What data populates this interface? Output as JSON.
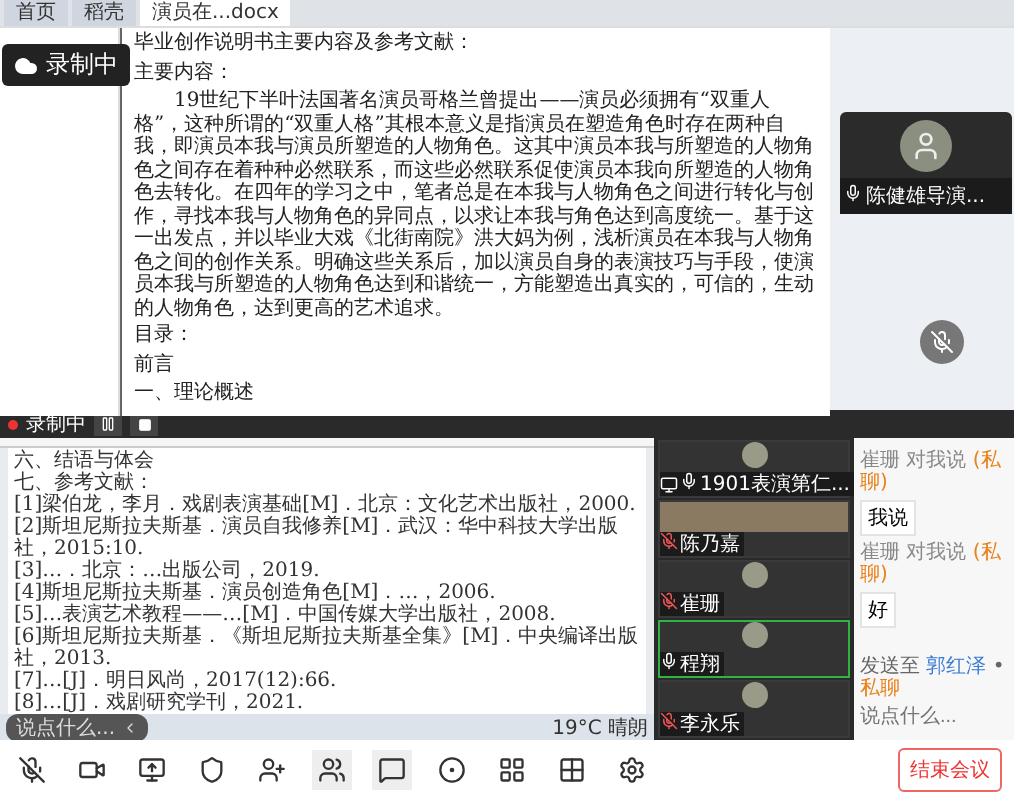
{
  "top_doc": {
    "tabs": [
      {
        "label": "首页",
        "selected": false
      },
      {
        "label": "稻壳",
        "selected": false
      },
      {
        "label": "演员在...docx",
        "selected": true
      }
    ],
    "recording_badge": "录制中",
    "heading": "毕业创作说明书主要内容及参考文献：",
    "subheading": "主要内容：",
    "paragraph": "19世纪下半叶法国著名演员哥格兰曾提出——演员必须拥有“双重人格”，这种所谓的“双重人格”其根本意义是指演员在塑造角色时存在两种自我，即演员本我与演员所塑造的人物角色。这其中演员本我与所塑造的人物角色之间存在着种种必然联系，而这些必然联系促使演员本我向所塑造的人物角色去转化。在四年的学习之中，笔者总是在本我与人物角色之间进行转化与创作，寻找本我与人物角色的异同点，以求让本我与角色达到高度统一。基于这一出发点，并以毕业大戏《北街南院》洪大妈为例，浅析演员在本我与人物角色之间的创作关系。明确这些关系后，加以演员自身的表演技巧与手段，使演员本我与所塑造的人物角色达到和谐统一，方能塑造出真实的，可信的，生动的人物角色，达到更高的艺术追求。",
    "outline": [
      "目录：",
      "前言",
      "一、理论概述"
    ]
  },
  "floating_participant": {
    "name": "陈健雄导演...",
    "muted": false
  },
  "recording_bar": {
    "label": "录制中"
  },
  "shared_doc": {
    "section_title": "六、结语与体会",
    "references_title": "七、参考文献：",
    "references": [
      "[1]梁伯龙，李月．戏剧表演基础[M]．北京：文化艺术出版社，2000.",
      "[2]斯坦尼斯拉夫斯基．演员自我修养[M]．武汉：华中科技大学出版社，2015:10.",
      "[3]…．北京：…出版公司，2019.",
      "[4]斯坦尼斯拉夫斯基．演员创造角色[M]．…，2006.",
      "[5]…表演艺术教程——…[M]．中国传媒大学出版社，2008.",
      "[6]斯坦尼斯拉夫斯基．《斯坦尼斯拉夫斯基全集》[M]．中央编译出版社，2013.",
      "[7]…[J]．明日风尚，2017(12):66.",
      "[8]…[J]．戏剧研究学刊，2021."
    ],
    "chat_hint": "说点什么...",
    "weather": "19°C 晴朗"
  },
  "participants": [
    {
      "name": "1901表演第仁...",
      "muted": false,
      "video": false,
      "speaking": false,
      "sharing": true
    },
    {
      "name": "陈乃嘉",
      "muted": true,
      "video": true,
      "speaking": false,
      "sharing": false
    },
    {
      "name": "崔珊",
      "muted": true,
      "video": false,
      "speaking": false,
      "sharing": false
    },
    {
      "name": "程翔",
      "muted": false,
      "video": false,
      "speaking": true,
      "sharing": false
    },
    {
      "name": "李永乐",
      "muted": true,
      "video": false,
      "speaking": false,
      "sharing": false
    }
  ],
  "chat": {
    "messages": [
      {
        "sender": "崔珊 对我说",
        "tag": "(私聊)",
        "text": "我说"
      },
      {
        "sender": "崔珊 对我说",
        "tag": "(私聊)",
        "text": "好"
      }
    ],
    "send_to_label": "发送至",
    "recipient": "郭红泽",
    "separator": "•",
    "mode": "私聊",
    "placeholder": "说点什么..."
  },
  "end_button": "结束会议"
}
